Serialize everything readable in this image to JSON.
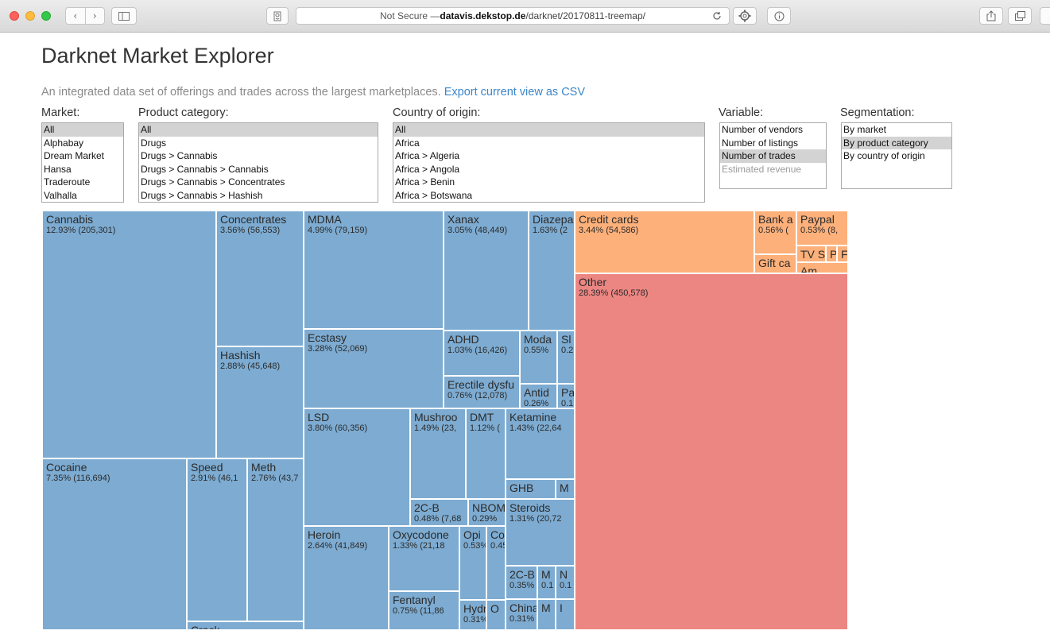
{
  "browser": {
    "address_prefix": "Not Secure — ",
    "address_host": "datavis.dekstop.de",
    "address_path": "/darknet/20170811-treemap/",
    "back_glyph": "‹",
    "forward_glyph": "›",
    "icons": [
      "sidebar-icon",
      "reader-icon",
      "reload-icon",
      "extension-icon",
      "info-icon",
      "share-icon",
      "tabs-icon"
    ]
  },
  "page": {
    "title": "Darknet Market Explorer",
    "subtitle": "An integrated data set of offerings and trades across the largest marketplaces.",
    "export_link": "Export current view as CSV"
  },
  "controls": {
    "market": {
      "label": "Market:",
      "options": [
        "All",
        "Alphabay",
        "Dream Market",
        "Hansa",
        "Traderoute",
        "Valhalla"
      ],
      "selected": "All"
    },
    "category": {
      "label": "Product category:",
      "options": [
        "All",
        "Drugs",
        "Drugs > Cannabis",
        "Drugs > Cannabis > Cannabis",
        "Drugs > Cannabis > Concentrates",
        "Drugs > Cannabis > Hashish"
      ],
      "selected": "All"
    },
    "country": {
      "label": "Country of origin:",
      "options": [
        "All",
        "Africa",
        "Africa > Algeria",
        "Africa > Angola",
        "Africa > Benin",
        "Africa > Botswana"
      ],
      "selected": "All"
    },
    "variable": {
      "label": "Variable:",
      "options": [
        "Number of vendors",
        "Number of listings",
        "Number of trades",
        "Estimated revenue"
      ],
      "selected": "Number of trades",
      "disabled": [
        "Estimated revenue"
      ]
    },
    "segmentation": {
      "label": "Segmentation:",
      "options": [
        "By market",
        "By product category",
        "By country of origin"
      ],
      "selected": "By product category"
    }
  },
  "colors": {
    "drugs": "#7dabd1",
    "cards": "#fdb07a",
    "other": "#ec8682",
    "link": "#3b86c9"
  },
  "treemap": {
    "cells": [
      {
        "group": "drug",
        "name": "Cannabis",
        "value": "12.93% (205,301)"
      },
      {
        "group": "drug",
        "name": "Concentrates",
        "value": "3.56% (56,553)"
      },
      {
        "group": "drug",
        "name": "Hashish",
        "value": "2.88% (45,648)"
      },
      {
        "group": "drug",
        "name": "Cocaine",
        "value": "7.35% (116,694)"
      },
      {
        "group": "drug",
        "name": "Speed",
        "value": "2.91% (46,1"
      },
      {
        "group": "drug",
        "name": "Meth",
        "value": "2.76% (43,7"
      },
      {
        "group": "drug",
        "name": "Crack",
        "value": ""
      },
      {
        "group": "drug",
        "name": "MDMA",
        "value": "4.99% (79,159)"
      },
      {
        "group": "drug",
        "name": "Ecstasy",
        "value": "3.28% (52,069)"
      },
      {
        "group": "drug",
        "name": "Xanax",
        "value": "3.05% (48,449)"
      },
      {
        "group": "drug",
        "name": "Diazepa",
        "value": "1.63% (2"
      },
      {
        "group": "drug",
        "name": "ADHD",
        "value": "1.03% (16,426)"
      },
      {
        "group": "drug",
        "name": "Moda",
        "value": "0.55%"
      },
      {
        "group": "drug",
        "name": "Sl",
        "value": "0.2"
      },
      {
        "group": "drug",
        "name": "Erectile dysfu",
        "value": "0.76% (12,078)"
      },
      {
        "group": "drug",
        "name": "Antid",
        "value": "0.26%"
      },
      {
        "group": "drug",
        "name": "Pa",
        "value": "0.1"
      },
      {
        "group": "drug",
        "name": "LSD",
        "value": "3.80% (60,356)"
      },
      {
        "group": "drug",
        "name": "Mushroo",
        "value": "1.49% (23,"
      },
      {
        "group": "drug",
        "name": "DMT",
        "value": "1.12% ("
      },
      {
        "group": "drug",
        "name": "2C-B",
        "value": "0.48% (7,68"
      },
      {
        "group": "drug",
        "name": "NBOM",
        "value": "0.29%"
      },
      {
        "group": "drug",
        "name": "Ketamine",
        "value": "1.43% (22,64"
      },
      {
        "group": "drug",
        "name": "GHB",
        "value": ""
      },
      {
        "group": "drug",
        "name": "M",
        "value": ""
      },
      {
        "group": "drug",
        "name": "Steroids",
        "value": "1.31% (20,72"
      },
      {
        "group": "drug",
        "name": "Heroin",
        "value": "2.64% (41,849)"
      },
      {
        "group": "drug",
        "name": "Oxycodone",
        "value": "1.33% (21,18"
      },
      {
        "group": "drug",
        "name": "Opi",
        "value": "0.53%"
      },
      {
        "group": "drug",
        "name": "Co",
        "value": "0.45"
      },
      {
        "group": "drug",
        "name": "Fentanyl",
        "value": "0.75% (11,86"
      },
      {
        "group": "drug",
        "name": "Hydr",
        "value": "0.31%"
      },
      {
        "group": "drug",
        "name": "O",
        "value": ""
      },
      {
        "group": "drug",
        "name": "2C-B",
        "value": "0.35%"
      },
      {
        "group": "drug",
        "name": "M",
        "value": "0.1"
      },
      {
        "group": "drug",
        "name": "N",
        "value": "0.1"
      },
      {
        "group": "drug",
        "name": "China",
        "value": "0.31%"
      },
      {
        "group": "drug",
        "name": "M",
        "value": ""
      },
      {
        "group": "drug",
        "name": "I",
        "value": ""
      },
      {
        "group": "card",
        "name": "Credit cards",
        "value": "3.44% (54,586)"
      },
      {
        "group": "card",
        "name": "Bank a",
        "value": "0.56% ("
      },
      {
        "group": "card",
        "name": "Gift ca",
        "value": ""
      },
      {
        "group": "card",
        "name": "Paypal",
        "value": "0.53% (8,"
      },
      {
        "group": "card",
        "name": "TV S",
        "value": ""
      },
      {
        "group": "card",
        "name": "P",
        "value": ""
      },
      {
        "group": "card",
        "name": "F",
        "value": ""
      },
      {
        "group": "card",
        "name": "Am",
        "value": ""
      },
      {
        "group": "other",
        "name": "Other",
        "value": "28.39% (450,578)"
      }
    ]
  }
}
